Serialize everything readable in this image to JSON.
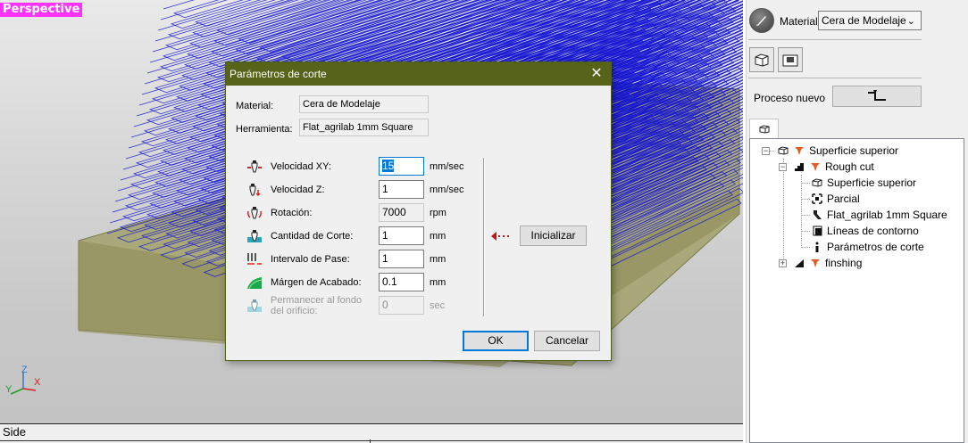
{
  "viewport": {
    "view_label": "Perspective",
    "bottom_label": "Side",
    "axes": {
      "z": "Z",
      "y": "Y",
      "x": "X"
    }
  },
  "panel": {
    "material_label": "Material",
    "material_value": "Cera de Modelaje",
    "process_label": "Proceso nuevo",
    "tree": [
      {
        "label": "Superficie superior"
      },
      {
        "label": "Rough cut"
      },
      {
        "label": "Superficie superior"
      },
      {
        "label": "Parcial"
      },
      {
        "label": "Flat_agrilab 1mm Square"
      },
      {
        "label": "Líneas de contorno"
      },
      {
        "label": "Parámetros de corte"
      },
      {
        "label": "finshing"
      }
    ]
  },
  "dialog": {
    "title": "Parámetros de corte",
    "material_label": "Material:",
    "material_value": "Cera de Modelaje",
    "tool_label": "Herramienta:",
    "tool_value": "Flat_agrilab 1mm Square",
    "rows": [
      {
        "label": "Velocidad XY:",
        "value": "15",
        "unit": "mm/sec"
      },
      {
        "label": "Velocidad Z:",
        "value": "1",
        "unit": "mm/sec"
      },
      {
        "label": "Rotación:",
        "value": "7000",
        "unit": "rpm"
      },
      {
        "label": "Cantidad de Corte:",
        "value": "1",
        "unit": "mm"
      },
      {
        "label": "Intervalo de Pase:",
        "value": "1",
        "unit": "mm"
      },
      {
        "label": "Márgen de Acabado:",
        "value": "0.1",
        "unit": "mm"
      },
      {
        "label": "Permanecer al fondo del orificio:",
        "label_line1": "Permanecer al fondo",
        "label_line2": "del orificio:",
        "value": "0",
        "unit": "sec"
      }
    ],
    "init_button": "Inicializar",
    "ok_button": "OK",
    "cancel_button": "Cancelar"
  },
  "colors": {
    "titlebar": "#566319",
    "toolpath": "#1414d2",
    "stock_top": "#a8a878",
    "stock_side": "#8c8c54",
    "view_label_bg": "#ff33ff"
  }
}
